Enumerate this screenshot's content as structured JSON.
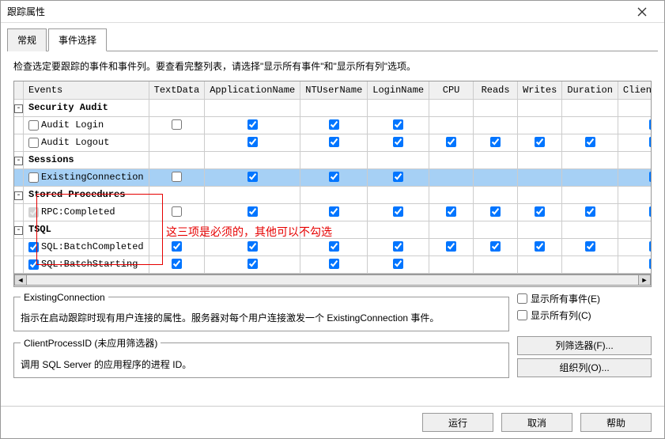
{
  "window": {
    "title": "跟踪属性"
  },
  "tabs": {
    "items": [
      "常规",
      "事件选择"
    ],
    "activeIndex": 1
  },
  "hint": "检查选定要跟踪的事件和事件列。要查看完整列表，请选择\"显示所有事件\"和\"显示所有列\"选项。",
  "columns": [
    "Events",
    "TextData",
    "ApplicationName",
    "NTUserName",
    "LoginName",
    "CPU",
    "Reads",
    "Writes",
    "Duration",
    "ClientProce"
  ],
  "rows": [
    {
      "type": "group",
      "label": "Security Audit",
      "expander": "-"
    },
    {
      "type": "event",
      "label": "Audit Login",
      "filter": false,
      "cells": [
        false,
        true,
        true,
        true,
        null,
        null,
        null,
        null,
        true
      ]
    },
    {
      "type": "event",
      "label": "Audit Logout",
      "filter": false,
      "cells": [
        null,
        true,
        true,
        true,
        true,
        true,
        true,
        true,
        true
      ]
    },
    {
      "type": "group",
      "label": "Sessions",
      "expander": "-"
    },
    {
      "type": "event",
      "label": "ExistingConnection",
      "filter": false,
      "highlight": true,
      "cells": [
        false,
        true,
        true,
        true,
        null,
        null,
        null,
        null,
        true
      ]
    },
    {
      "type": "group",
      "label": "Stored Procedures",
      "expander": "-"
    },
    {
      "type": "event",
      "label": "RPC:Completed",
      "filter": true,
      "disabled": true,
      "cells": [
        false,
        true,
        true,
        true,
        true,
        true,
        true,
        true,
        true
      ]
    },
    {
      "type": "group",
      "label": "TSQL",
      "expander": "-"
    },
    {
      "type": "event",
      "label": "SQL:BatchCompleted",
      "filter": true,
      "cells": [
        true,
        true,
        true,
        true,
        true,
        true,
        true,
        true,
        true
      ]
    },
    {
      "type": "event",
      "label": "SQL:BatchStarting",
      "filter": true,
      "cells": [
        true,
        true,
        true,
        true,
        null,
        null,
        null,
        null,
        true
      ]
    }
  ],
  "annotation": "这三项是必须的，其他可以不勾选",
  "desc1": {
    "title": "ExistingConnection",
    "body": "指示在启动跟踪时现有用户连接的属性。服务器对每个用户连接激发一个 ExistingConnection 事件。"
  },
  "desc2": {
    "title": "ClientProcessID (未应用筛选器)",
    "body": "调用 SQL Server 的应用程序的进程 ID。"
  },
  "options": {
    "showAllEvents": "显示所有事件(E)",
    "showAllCols": "显示所有列(C)"
  },
  "buttons": {
    "colFilter": "列筛选器(F)...",
    "orgCols": "组织列(O)...",
    "run": "运行",
    "cancel": "取消",
    "help": "帮助"
  }
}
